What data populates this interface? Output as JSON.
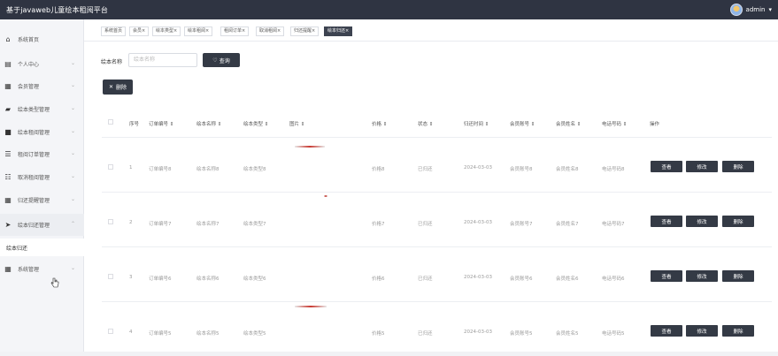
{
  "app": {
    "title": "基于javaweb儿童绘本租阅平台",
    "user": "admin"
  },
  "sidebar": {
    "items": [
      {
        "label": "系统首页",
        "icon": "home-icon"
      },
      {
        "label": "个人中心",
        "icon": "user-card-icon"
      },
      {
        "label": "会员管理",
        "icon": "grid-icon"
      },
      {
        "label": "绘本类型管理",
        "icon": "book-shelf-icon"
      },
      {
        "label": "绘本租阅管理",
        "icon": "book-icon"
      },
      {
        "label": "租阅订单管理",
        "icon": "list-icon"
      },
      {
        "label": "取消租阅管理",
        "icon": "sliders-icon"
      },
      {
        "label": "归还提醒管理",
        "icon": "grid-icon"
      },
      {
        "label": "绘本归还管理",
        "icon": "send-icon"
      },
      {
        "label": "系统管理",
        "icon": "grid-icon"
      }
    ],
    "subitem": "绘本归还"
  },
  "tabs": [
    {
      "label": "系统首页"
    },
    {
      "label": "会员×"
    },
    {
      "label": "绘本类型×"
    },
    {
      "label": "绘本租阅×"
    },
    {
      "label": "租阅订单×"
    },
    {
      "label": "取消租阅×"
    },
    {
      "label": "归还提醒×"
    },
    {
      "label": "绘本归还×"
    }
  ],
  "search": {
    "label": "绘本名称",
    "placeholder": "绘本名称",
    "button": "查询"
  },
  "bulk_delete": "删除",
  "table": {
    "headers": [
      "序号",
      "订单编号 ⇕",
      "绘本名称 ⇕",
      "绘本类型 ⇕",
      "图片 ⇕",
      "价格 ⇕",
      "状态 ⇕",
      "归还时间 ⇕",
      "会员账号 ⇕",
      "会员姓名 ⇕",
      "电话号码 ⇕",
      "操作"
    ],
    "rows": [
      {
        "no": "1",
        "order": "订单编号8",
        "name": "绘本名称8",
        "type": "绘本类型8",
        "price": "价格8",
        "status": "已归还",
        "date": "2024-03-03",
        "account": "会员账号8",
        "member": "会员姓名8",
        "phone": "电话号码8"
      },
      {
        "no": "2",
        "order": "订单编号7",
        "name": "绘本名称7",
        "type": "绘本类型7",
        "price": "价格7",
        "status": "已归还",
        "date": "2024-03-03",
        "account": "会员账号7",
        "member": "会员姓名7",
        "phone": "电话号码7"
      },
      {
        "no": "3",
        "order": "订单编号6",
        "name": "绘本名称6",
        "type": "绘本类型6",
        "price": "价格6",
        "status": "已归还",
        "date": "2024-03-03",
        "account": "会员账号6",
        "member": "会员姓名6",
        "phone": "电话号码6"
      },
      {
        "no": "4",
        "order": "订单编号5",
        "name": "绘本名称5",
        "type": "绘本类型5",
        "price": "价格5",
        "status": "已归还",
        "date": "2024-03-03",
        "account": "会员账号5",
        "member": "会员姓名5",
        "phone": "电话号码5"
      }
    ],
    "actions": {
      "view": "查看",
      "edit": "修改",
      "delete": "删除"
    }
  }
}
